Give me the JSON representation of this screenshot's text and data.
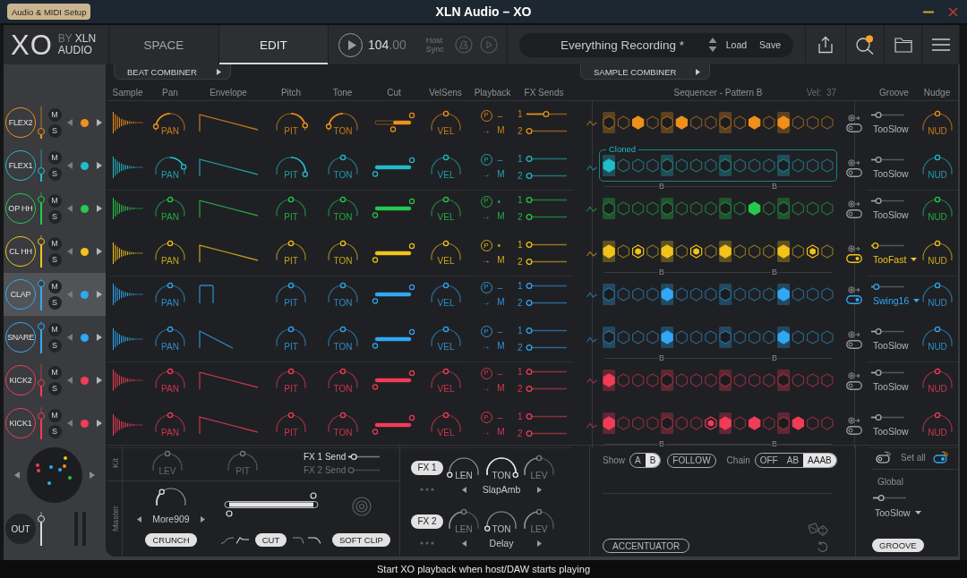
{
  "window": {
    "title": "XLN Audio – XO",
    "setup_button": "Audio & MIDI Setup"
  },
  "header": {
    "logo": {
      "mark": "XO",
      "by": "BY",
      "brand": "XLN",
      "sub": "AUDIO"
    },
    "tabs": [
      {
        "label": "SPACE",
        "selected": false
      },
      {
        "label": "EDIT",
        "selected": true
      }
    ],
    "tempo": {
      "whole": "104",
      "fraction": ".00"
    },
    "host_sync": "Host Sync",
    "preset": {
      "name": "Everything Recording *",
      "load": "Load",
      "save": "Save"
    }
  },
  "combiners": {
    "beat": "BEAT COMBINER",
    "sample": "SAMPLE COMBINER"
  },
  "columns": [
    "Sample",
    "Pan",
    "Envelope",
    "Pitch",
    "Tone",
    "Cut",
    "VelSens",
    "Playback",
    "FX Sends"
  ],
  "sequencer": {
    "title": "Sequencer - Pattern B",
    "velocity": "Vel:  37",
    "groove": "Groove",
    "nudge": "Nudge"
  },
  "channels": [
    {
      "name": "FLEX2",
      "color": "#f0901a",
      "selected": false,
      "fader": {
        "level": 0.22
      },
      "mute": "M",
      "solo": "S",
      "pan": {
        "label": "PAN",
        "level": 0.08
      },
      "envelope": {
        "kind": "long"
      },
      "pitch": {
        "label": "PIT",
        "level": 0.9
      },
      "tone": {
        "label": "TON",
        "level": 0.08
      },
      "cut": {
        "level": 0.5
      },
      "velsens": {
        "label": "VEL",
        "level": 0.5
      },
      "playback": {
        "icon": "P",
        "mode": "–",
        "arrow": "→",
        "route": "M"
      },
      "sends": [
        {
          "label": "1",
          "level": 0.45
        },
        {
          "label": "2",
          "level": 0
        }
      ],
      "steps": [
        {
          "on": false,
          "soft": false
        },
        {
          "on": false,
          "soft": false
        },
        {
          "on": true,
          "soft": false
        },
        {
          "on": false,
          "soft": false
        },
        {
          "on": false,
          "soft": false
        },
        {
          "on": true,
          "soft": false
        },
        {
          "on": false,
          "soft": false
        },
        {
          "on": false,
          "soft": false
        },
        {
          "on": false,
          "soft": false
        },
        {
          "on": false,
          "soft": false
        },
        {
          "on": true,
          "soft": false
        },
        {
          "on": false,
          "soft": false
        },
        {
          "on": true,
          "soft": false
        },
        {
          "on": false,
          "soft": false
        },
        {
          "on": false,
          "soft": false
        },
        {
          "on": false,
          "soft": false
        }
      ],
      "groove": {
        "on": false,
        "name": "TooSlow",
        "level": 0.15
      },
      "nudge": {
        "label": "NUD",
        "level": 0.5
      }
    },
    {
      "name": "FLEX1",
      "color": "#20bccb",
      "selected": false,
      "fader": {
        "level": 0.33
      },
      "mute": "M",
      "solo": "S",
      "pan": {
        "label": "PAN",
        "level": 0.85
      },
      "envelope": {
        "kind": "long"
      },
      "pitch": {
        "label": "PIT",
        "level": 1
      },
      "tone": {
        "label": "TON",
        "level": 0.5
      },
      "cut": {
        "level": 1
      },
      "velsens": {
        "label": "VEL",
        "level": 0.5
      },
      "playback": {
        "icon": "P",
        "mode": "–",
        "arrow": "→",
        "route": "M"
      },
      "sends": [
        {
          "label": "1",
          "level": 0
        },
        {
          "label": "2",
          "level": 0
        }
      ],
      "clone_label": "Cloned",
      "steps": [
        {
          "on": true,
          "soft": false
        },
        {
          "on": false,
          "soft": false
        },
        {
          "on": false,
          "soft": false
        },
        {
          "on": false,
          "soft": false
        },
        {
          "on": false,
          "soft": false
        },
        {
          "on": false,
          "soft": false
        },
        {
          "on": false,
          "soft": false
        },
        {
          "on": false,
          "soft": false
        },
        {
          "on": false,
          "soft": false
        },
        {
          "on": false,
          "soft": false
        },
        {
          "on": false,
          "soft": false
        },
        {
          "on": false,
          "soft": false
        },
        {
          "on": false,
          "soft": false
        },
        {
          "on": false,
          "soft": false
        },
        {
          "on": false,
          "soft": false
        },
        {
          "on": false,
          "soft": false
        }
      ],
      "markers": [
        "B",
        "B"
      ],
      "groove": {
        "on": false,
        "name": "TooSlow",
        "level": 0.15
      },
      "nudge": {
        "label": "NUD",
        "level": 0.5
      }
    },
    {
      "name": "OP HH",
      "color": "#25c94b",
      "selected": false,
      "fader": {
        "level": 0.78
      },
      "mute": "M",
      "solo": "S",
      "pan": {
        "label": "PAN",
        "level": 0.5
      },
      "envelope": {
        "kind": "long"
      },
      "pitch": {
        "label": "PIT",
        "level": 0.5
      },
      "tone": {
        "label": "TON",
        "level": 0.5
      },
      "cut": {
        "level": 1
      },
      "velsens": {
        "label": "VEL",
        "level": 0.5
      },
      "playback": {
        "icon": "P",
        "mode": "•",
        "arrow": "→",
        "route": "M"
      },
      "sends": [
        {
          "label": "1",
          "level": 0
        },
        {
          "label": "2",
          "level": 0
        }
      ],
      "steps": [
        {
          "on": false,
          "soft": false
        },
        {
          "on": false,
          "soft": false
        },
        {
          "on": false,
          "soft": false
        },
        {
          "on": false,
          "soft": false
        },
        {
          "on": false,
          "soft": false
        },
        {
          "on": false,
          "soft": false
        },
        {
          "on": false,
          "soft": false
        },
        {
          "on": false,
          "soft": false
        },
        {
          "on": false,
          "soft": false
        },
        {
          "on": false,
          "soft": false
        },
        {
          "on": true,
          "soft": false
        },
        {
          "on": false,
          "soft": false
        },
        {
          "on": false,
          "soft": false
        },
        {
          "on": false,
          "soft": false
        },
        {
          "on": false,
          "soft": false
        },
        {
          "on": false,
          "soft": false
        }
      ],
      "groove": {
        "on": false,
        "name": "TooSlow",
        "level": 0.15
      },
      "nudge": {
        "label": "NUD",
        "level": 0.5
      }
    },
    {
      "name": "CL HH",
      "color": "#f2c31b",
      "selected": false,
      "fader": {
        "level": 0.8
      },
      "mute": "M",
      "solo": "S",
      "pan": {
        "label": "PAN",
        "level": 0.5
      },
      "envelope": {
        "kind": "long"
      },
      "pitch": {
        "label": "PIT",
        "level": 0.5
      },
      "tone": {
        "label": "TON",
        "level": 0.5
      },
      "cut": {
        "level": 1
      },
      "velsens": {
        "label": "VEL",
        "level": 0.5
      },
      "playback": {
        "icon": "P",
        "mode": "•",
        "arrow": "→",
        "route": "M"
      },
      "sends": [
        {
          "label": "1",
          "level": 0
        },
        {
          "label": "2",
          "level": 0
        }
      ],
      "steps": [
        {
          "on": true,
          "soft": false
        },
        {
          "on": false,
          "soft": false
        },
        {
          "on": true,
          "soft": true
        },
        {
          "on": false,
          "soft": false
        },
        {
          "on": true,
          "soft": false
        },
        {
          "on": false,
          "soft": false
        },
        {
          "on": true,
          "soft": true
        },
        {
          "on": false,
          "soft": false
        },
        {
          "on": true,
          "soft": false
        },
        {
          "on": false,
          "soft": false
        },
        {
          "on": false,
          "soft": false
        },
        {
          "on": false,
          "soft": false
        },
        {
          "on": true,
          "soft": false
        },
        {
          "on": false,
          "soft": false
        },
        {
          "on": true,
          "soft": true
        },
        {
          "on": false,
          "soft": false
        }
      ],
      "markers": [
        "B",
        "B"
      ],
      "groove": {
        "on": true,
        "name": "TooFast",
        "level": 0.05
      },
      "nudge": {
        "label": "NUD",
        "level": 0.5
      }
    },
    {
      "name": "CLAP",
      "color": "#30a8f5",
      "selected": true,
      "fader": {
        "level": 0.83
      },
      "mute": "M",
      "solo": "S",
      "pan": {
        "label": "PAN",
        "level": 0.5
      },
      "envelope": {
        "kind": "gate"
      },
      "pitch": {
        "label": "PIT",
        "level": 0.5
      },
      "tone": {
        "label": "TON",
        "level": 0.5
      },
      "cut": {
        "level": 1
      },
      "velsens": {
        "label": "VEL",
        "level": 0.5
      },
      "playback": {
        "icon": "P",
        "mode": "–",
        "arrow": "→",
        "route": "M"
      },
      "sends": [
        {
          "label": "1",
          "level": 0
        },
        {
          "label": "2",
          "level": 0
        }
      ],
      "steps": [
        {
          "on": false,
          "soft": false
        },
        {
          "on": false,
          "soft": false
        },
        {
          "on": false,
          "soft": false
        },
        {
          "on": false,
          "soft": false
        },
        {
          "on": true,
          "soft": false
        },
        {
          "on": false,
          "soft": false
        },
        {
          "on": false,
          "soft": false
        },
        {
          "on": false,
          "soft": false
        },
        {
          "on": false,
          "soft": false
        },
        {
          "on": false,
          "soft": false
        },
        {
          "on": false,
          "soft": false
        },
        {
          "on": false,
          "soft": false
        },
        {
          "on": true,
          "soft": false
        },
        {
          "on": false,
          "soft": false
        },
        {
          "on": false,
          "soft": false
        },
        {
          "on": false,
          "soft": false
        }
      ],
      "groove": {
        "on": true,
        "name": "Swing16",
        "level": 0.08
      },
      "nudge": {
        "label": "NUD",
        "level": 0.5
      }
    },
    {
      "name": "SNARE",
      "color": "#30a8f5",
      "selected": false,
      "fader": {
        "level": 0.83
      },
      "mute": "M",
      "solo": "S",
      "pan": {
        "label": "PAN",
        "level": 0.5
      },
      "envelope": {
        "kind": "short"
      },
      "pitch": {
        "label": "PIT",
        "level": 0.5
      },
      "tone": {
        "label": "TON",
        "level": 0.5
      },
      "cut": {
        "level": 1
      },
      "velsens": {
        "label": "VEL",
        "level": 0.5
      },
      "playback": {
        "icon": "P",
        "mode": "–",
        "arrow": "→",
        "route": "M"
      },
      "sends": [
        {
          "label": "1",
          "level": 0
        },
        {
          "label": "2",
          "level": 0
        }
      ],
      "steps": [
        {
          "on": false,
          "soft": false
        },
        {
          "on": false,
          "soft": false
        },
        {
          "on": false,
          "soft": false
        },
        {
          "on": false,
          "soft": false
        },
        {
          "on": true,
          "soft": false
        },
        {
          "on": false,
          "soft": false
        },
        {
          "on": false,
          "soft": false
        },
        {
          "on": false,
          "soft": false
        },
        {
          "on": false,
          "soft": false
        },
        {
          "on": false,
          "soft": false
        },
        {
          "on": false,
          "soft": false
        },
        {
          "on": false,
          "soft": false
        },
        {
          "on": true,
          "soft": false
        },
        {
          "on": false,
          "soft": false
        },
        {
          "on": false,
          "soft": false
        },
        {
          "on": false,
          "soft": false
        }
      ],
      "markers": [
        "B",
        "B"
      ],
      "groove": {
        "on": false,
        "name": "TooSlow",
        "level": 0.15
      },
      "nudge": {
        "label": "NUD",
        "level": 0.5
      }
    },
    {
      "name": "KICK2",
      "color": "#f23c57",
      "selected": false,
      "fader": {
        "level": 0.42
      },
      "mute": "M",
      "solo": "S",
      "pan": {
        "label": "PAN",
        "level": 0.5
      },
      "envelope": {
        "kind": "long"
      },
      "pitch": {
        "label": "PIT",
        "level": 0.5
      },
      "tone": {
        "label": "TON",
        "level": 0.5
      },
      "cut": {
        "level": 1
      },
      "velsens": {
        "label": "VEL",
        "level": 0.5
      },
      "playback": {
        "icon": "P",
        "mode": "–",
        "arrow": "→",
        "route": "M"
      },
      "sends": [
        {
          "label": "1",
          "level": 0
        },
        {
          "label": "2",
          "level": 0
        }
      ],
      "steps": [
        {
          "on": true,
          "soft": false
        },
        {
          "on": false,
          "soft": false
        },
        {
          "on": false,
          "soft": false
        },
        {
          "on": false,
          "soft": false
        },
        {
          "on": false,
          "soft": false
        },
        {
          "on": false,
          "soft": false
        },
        {
          "on": false,
          "soft": false
        },
        {
          "on": false,
          "soft": false
        },
        {
          "on": false,
          "soft": false
        },
        {
          "on": false,
          "soft": false
        },
        {
          "on": false,
          "soft": false
        },
        {
          "on": false,
          "soft": false
        },
        {
          "on": false,
          "soft": false
        },
        {
          "on": false,
          "soft": false
        },
        {
          "on": false,
          "soft": false
        },
        {
          "on": false,
          "soft": false
        }
      ],
      "groove": {
        "on": false,
        "name": "TooSlow",
        "level": 0.15
      },
      "nudge": {
        "label": "NUD",
        "level": 0.5
      }
    },
    {
      "name": "KICK1",
      "color": "#f23c57",
      "selected": false,
      "fader": {
        "level": 0.72
      },
      "mute": "M",
      "solo": "S",
      "pan": {
        "label": "PAN",
        "level": 0.5
      },
      "envelope": {
        "kind": "long"
      },
      "pitch": {
        "label": "PIT",
        "level": 0.5
      },
      "tone": {
        "label": "TON",
        "level": 0.5
      },
      "cut": {
        "level": 1
      },
      "velsens": {
        "label": "VEL",
        "level": 0.5
      },
      "playback": {
        "icon": "P",
        "mode": "–",
        "arrow": "→",
        "route": "M"
      },
      "sends": [
        {
          "label": "1",
          "level": 0
        },
        {
          "label": "2",
          "level": 0
        }
      ],
      "steps": [
        {
          "on": true,
          "soft": false
        },
        {
          "on": false,
          "soft": false
        },
        {
          "on": false,
          "soft": false
        },
        {
          "on": false,
          "soft": false
        },
        {
          "on": false,
          "soft": false
        },
        {
          "on": false,
          "soft": false
        },
        {
          "on": false,
          "soft": false
        },
        {
          "on": true,
          "soft": true
        },
        {
          "on": true,
          "soft": false
        },
        {
          "on": false,
          "soft": false
        },
        {
          "on": true,
          "soft": false
        },
        {
          "on": false,
          "soft": false
        },
        {
          "on": false,
          "soft": false
        },
        {
          "on": true,
          "soft": false
        },
        {
          "on": false,
          "soft": false
        },
        {
          "on": false,
          "soft": false
        }
      ],
      "markers": [
        "B",
        "B"
      ],
      "groove": {
        "on": false,
        "name": "TooSlow",
        "level": 0.15
      },
      "nudge": {
        "label": "NUD",
        "level": 0.5
      }
    }
  ],
  "out": {
    "label": "OUT",
    "fader": {
      "level": 0.78
    },
    "meters": [
      {
        "level": 0
      },
      {
        "level": 0
      }
    ]
  },
  "kit": {
    "label": "Kit",
    "knobs": [
      {
        "label": "LEV",
        "level": 0.5
      },
      {
        "label": "PIT",
        "level": 0.5
      }
    ],
    "sends": [
      {
        "label": "FX 1 Send",
        "level": 0.1,
        "disabled": false
      },
      {
        "label": "FX 2 Send",
        "level": 0,
        "disabled": true
      }
    ]
  },
  "master": {
    "label": "Master",
    "crunch": {
      "level": 0.3,
      "preset": "More909",
      "button": "CRUNCH"
    },
    "cut": {
      "range": [
        {
          "level": 0.03
        },
        {
          "level": 0.97
        }
      ],
      "button": "CUT"
    },
    "soft_clip": {
      "button": "SOFT CLIP"
    }
  },
  "fx": [
    {
      "label": "FX 1",
      "preset": "SlapAmb",
      "knobs": [
        {
          "label": "LEN",
          "level": 0,
          "disabled": false
        },
        {
          "label": "TON",
          "level": 1,
          "disabled": false
        },
        {
          "label": "LEV",
          "level": 0.5,
          "disabled": true
        }
      ]
    },
    {
      "label": "FX 2",
      "preset": "Delay",
      "knobs": [
        {
          "label": "LEN",
          "level": 0.5,
          "disabled": true
        },
        {
          "label": "TON",
          "level": 0,
          "disabled": false
        },
        {
          "label": "LEV",
          "level": 0.5,
          "disabled": true
        }
      ]
    }
  ],
  "sequencer_controls": {
    "show_label": "Show",
    "show": [
      {
        "label": "A",
        "selected": false
      },
      {
        "label": "B",
        "selected": true
      }
    ],
    "follow": "FOLLOW",
    "chain_label": "Chain",
    "chain": [
      {
        "label": "OFF",
        "selected": false
      },
      {
        "label": "AB",
        "selected": false
      },
      {
        "label": "AAAB",
        "selected": true
      }
    ],
    "accentuator": "ACCENTUATOR"
  },
  "groove_panel": {
    "set_all": "Set all",
    "global_label": "Global",
    "global": {
      "name": "TooSlow",
      "level": 0.18
    },
    "button": "GROOVE"
  },
  "status_bar": "Start XO playback when host/DAW starts playing"
}
